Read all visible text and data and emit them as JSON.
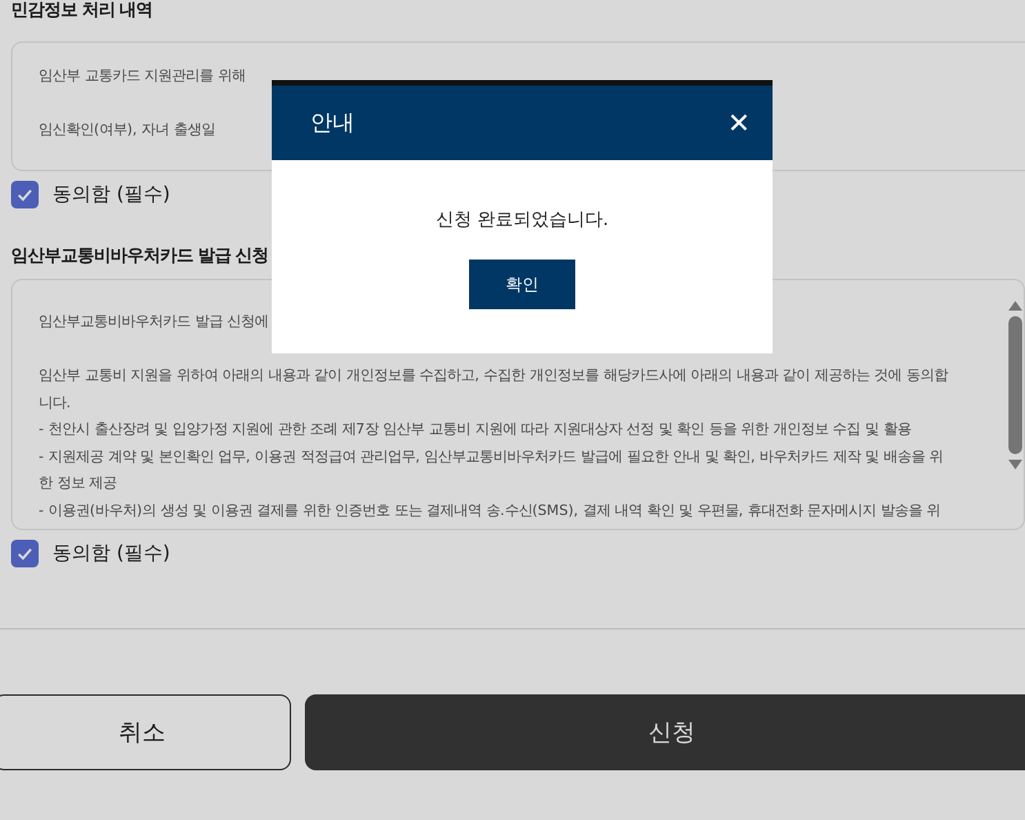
{
  "sections": [
    {
      "title": "민감정보 처리 내역",
      "paragraphs": [
        [
          "임산부 교통카드 지원관리를 위해"
        ],
        [
          "임신확인(여부), 자녀 출생일"
        ]
      ],
      "scrollable": false,
      "consent": {
        "label": "동의함 (필수)",
        "checked": true
      }
    },
    {
      "title": "임산부교통비바우처카드 발급 신청",
      "paragraphs": [
        [
          "임산부교통비바우처카드 발급 신청에"
        ],
        [
          "임산부 교통비 지원을 위하여 아래의 내용과 같이 개인정보를 수집하고, 수집한 개인정보를 해당카드사에 아래의 내용과 같이 제공하는 것에 동의합",
          "니다.",
          "- 천안시 출산장려 및 입양가정 지원에 관한 조례 제7장 임산부 교통비 지원에 따라 지원대상자 선정 및 확인 등을 위한 개인정보 수집 및 활용",
          "- 지원제공 계약 및 본인확인 업무, 이용권 적정급여 관리업무, 임산부교통비바우처카드 발급에 필요한 안내 및 확인, 바우처카드 제작 및 배송을 위",
          "한 정보 제공",
          "- 이용권(바우처)의 생성 및 이용권 결제를 위한 인증번호 또는 결제내역 송.수신(SMS), 결제 내역 확인 및 우편물, 휴대전화 문자메시지 발송을 위"
        ]
      ],
      "scrollable": true,
      "consent": {
        "label": "동의함 (필수)",
        "checked": true
      }
    }
  ],
  "buttons": [
    {
      "label": "취소",
      "kind": "secondary"
    },
    {
      "label": "신청",
      "kind": "primary"
    }
  ],
  "dialog": {
    "title": "안내",
    "close": "✕",
    "message": "신청 완료되었습니다.",
    "confirm": "확인"
  }
}
